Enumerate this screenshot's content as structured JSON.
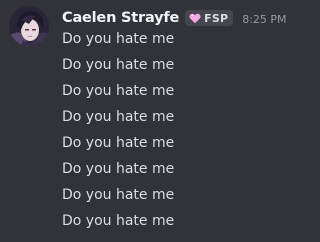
{
  "message": {
    "author": "Caelen Strayfe",
    "tag": {
      "icon": "heart-icon",
      "text": "FSP",
      "color": "#f9a8e6"
    },
    "timestamp": "8:25 PM",
    "avatar": "avatar-image",
    "lines": [
      "Do you hate me",
      "Do you hate me",
      "Do you hate me",
      "Do you hate me",
      "Do you hate me",
      "Do you hate me",
      "Do you hate me",
      "Do you hate me"
    ]
  },
  "colors": {
    "background": "#313338",
    "username": "#f2f3f5",
    "text": "#dbdee1",
    "timestamp": "#949ba4",
    "tag_background": "#45464e"
  }
}
